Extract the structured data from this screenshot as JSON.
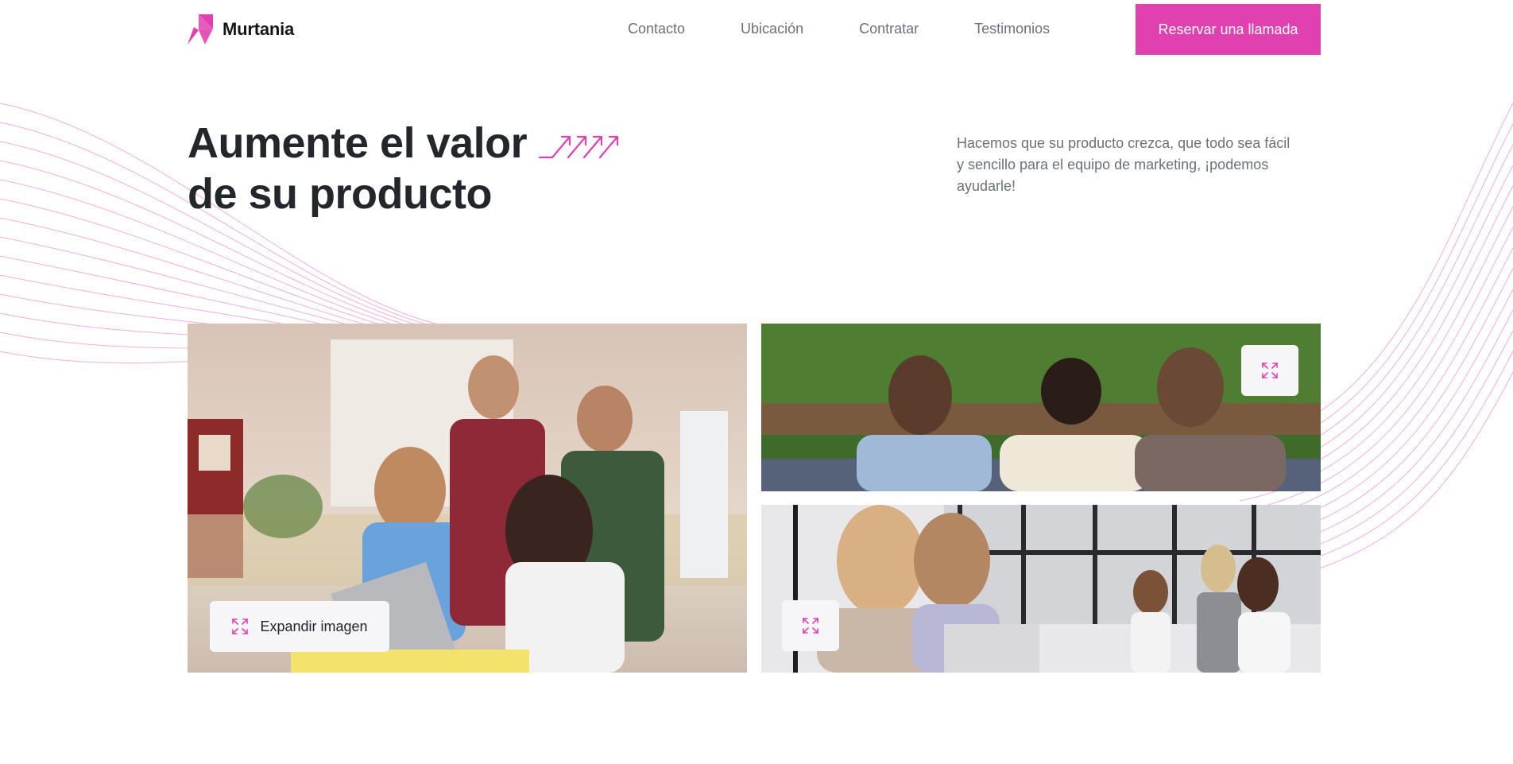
{
  "brand": {
    "name": "Murtania",
    "accent": "#e040b0"
  },
  "nav": {
    "items": [
      "Contacto",
      "Ubicación",
      "Contratar",
      "Testimonios"
    ],
    "cta_label": "Reservar una llamada"
  },
  "hero": {
    "title_line1": "Aumente el valor",
    "title_line2": "de su producto",
    "description": "Hacemos que su producto crezca, que todo sea fácil y sencillo para el equipo de marketing, ¡podemos ayudarle!"
  },
  "gallery": {
    "expand_label": "Expandir imagen",
    "images": [
      {
        "alt": "team-meeting-laptop"
      },
      {
        "alt": "students-green-wall"
      },
      {
        "alt": "office-women-laptop"
      }
    ]
  },
  "icons": [
    "logo-mark",
    "growth-arrows-icon",
    "expand-icon"
  ]
}
